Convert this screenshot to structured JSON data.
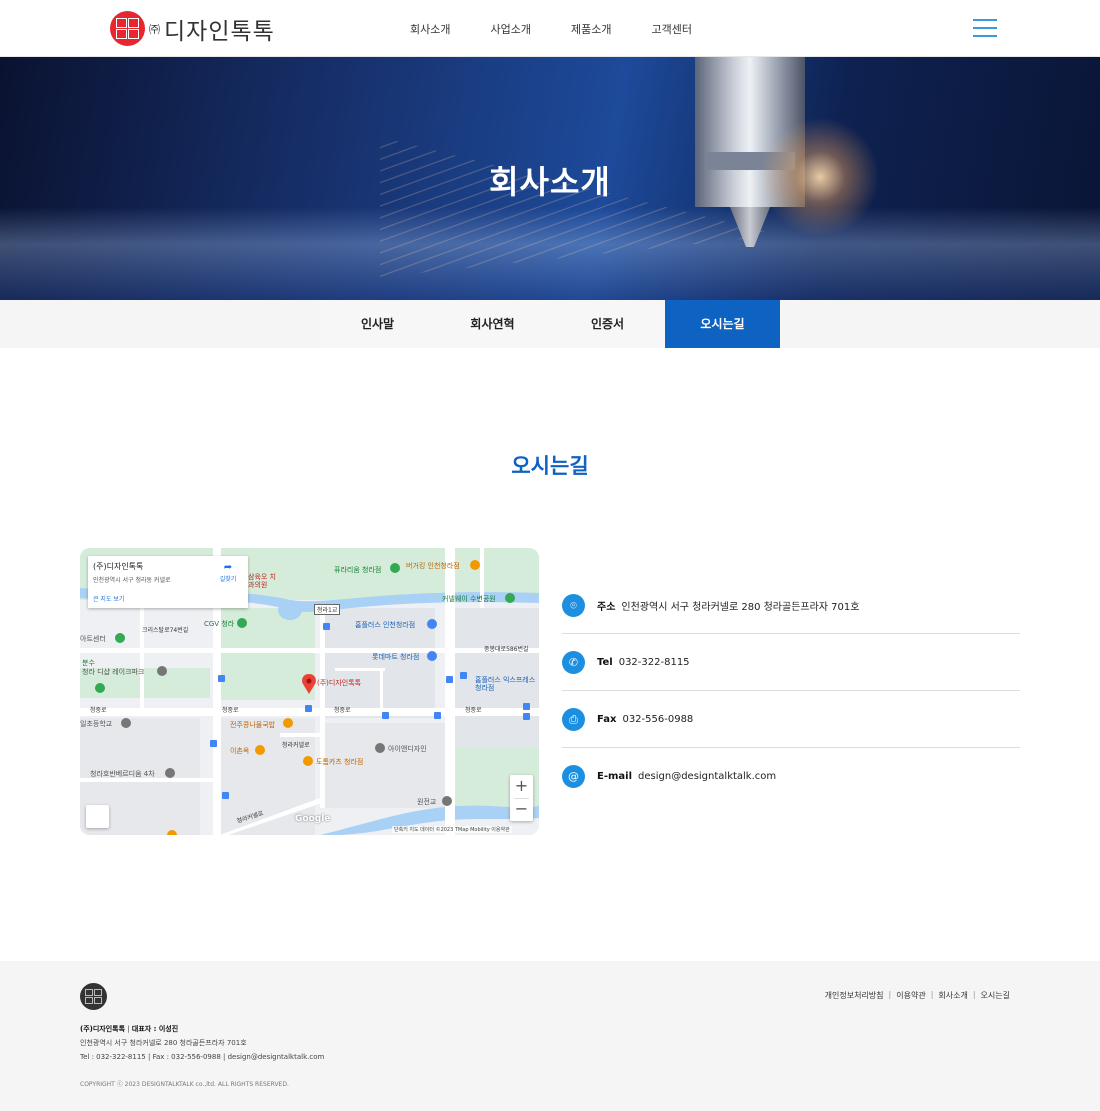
{
  "header": {
    "logo_co": "㈜",
    "logo_name": "디자인톡톡",
    "nav": [
      "회사소개",
      "사업소개",
      "제품소개",
      "고객센터"
    ],
    "menu_icon": "hamburger-icon"
  },
  "hero": {
    "title": "회사소개"
  },
  "subnav": {
    "items": [
      "인사말",
      "회사연혁",
      "인증서",
      "오시는길"
    ],
    "active": "오시는길",
    "active_color": "#0d62c2"
  },
  "section": {
    "title": "오시는길",
    "title_color": "#0d62c2"
  },
  "map": {
    "card_title": "(주)디자인톡톡",
    "card_address": "인천광역시 서구 청라동 커넬로",
    "card_link": "큰 지도 보기",
    "card_directions": "길찾기",
    "labels": {
      "pin": "(주)디자인톡톡",
      "l1": "퓨라리움 청라점",
      "l2": "버거킹 인천청라점",
      "l3": "커넬웨이 수변공원",
      "l4": "홈플러스 인천청라점",
      "l5": "롯데마트 청라점",
      "l6": "CGV 청라",
      "l7": "크리스탈로74번길",
      "l8": "청라 디샵 레이크파크",
      "l9": "전주콩나물국밥",
      "l10": "이촌옥",
      "l11": "도톰카츠 청라점",
      "l12": "아이앤디자인",
      "l13": "청라호반베르디움 4차",
      "l14": "청중로",
      "l15": "청라커넬로",
      "l16": "홈플러스 익스프레스 청라점",
      "l17": "중봉대로586번길",
      "l18": "원전교",
      "l19": "삼육오 치과의원",
      "l20": "청라1교",
      "l21": "아트센터",
      "l22": "분수",
      "l23": "일초등학교",
      "l24": "청중로",
      "l25": "청중로",
      "l26": "청중로",
      "l27": "청라커넬로"
    },
    "google": "Google",
    "attribution": "단축키   지도 데이터 ©2023 TMap Mobility   이용약관",
    "zoom_in": "+",
    "zoom_out": "−"
  },
  "contact": [
    {
      "icon": "location-pin-icon",
      "glyph": "⌾",
      "label": "주소",
      "value": "인천광역시 서구 청라커넬로 280 청라골든프라자 701호"
    },
    {
      "icon": "phone-icon",
      "glyph": "✆",
      "label": "Tel",
      "value": "032-322-8115"
    },
    {
      "icon": "fax-printer-icon",
      "glyph": "⎙",
      "label": "Fax",
      "value": "032-556-0988"
    },
    {
      "icon": "at-email-icon",
      "glyph": "@",
      "label": "E-mail",
      "value": "design@designtalktalk.com"
    }
  ],
  "contact_icon_color": "#1d8fe0",
  "footer": {
    "links": [
      "개인정보처리방침",
      "이용약관",
      "회사소개",
      "오시는길"
    ],
    "company": "(주)디자인톡톡",
    "ceo": "대표자 : 이성진",
    "address": "인천광역시 서구 청라커넬로 280 청라골든프라자 701호",
    "tel": "Tel : 032-322-8115",
    "fax": "Fax : 032-556-0988",
    "email": "design@designtalktalk.com",
    "copyright": "COPYRIGHT ⓒ 2023 DESIGNTALKTALK co.,ltd. ALL RIGHTS RESERVED."
  },
  "brand_red": "#e8262f"
}
